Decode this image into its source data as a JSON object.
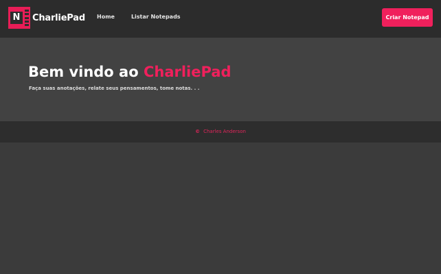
{
  "navbar": {
    "logo_letter": "N",
    "brand_name": "CharliePad",
    "links": [
      {
        "label": "Home"
      },
      {
        "label": "Listar Notepads"
      }
    ],
    "cta_label": "Criar Notepad"
  },
  "hero": {
    "title_prefix": "Bem vindo ao ",
    "title_accent": "CharliePad",
    "subtitle": "Faça suas anotações, relate seus pensamentos, tome notas. . ."
  },
  "footer": {
    "copyright_symbol": "©",
    "author": "Charles Anderson"
  },
  "colors": {
    "accent": "#f0205c",
    "navbar_bg": "#2c2c2c",
    "hero_bg": "#424242",
    "page_bg": "#3b3b3b"
  }
}
